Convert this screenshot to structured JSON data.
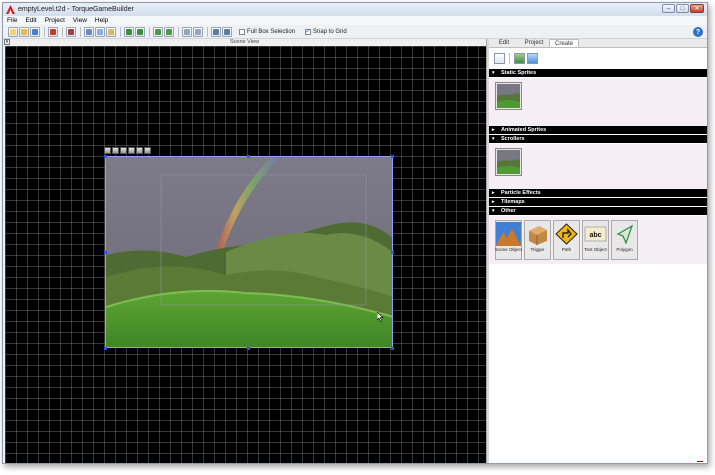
{
  "window": {
    "title": "emptyLevel.t2d - TorqueGameBuilder"
  },
  "menu": [
    "File",
    "Edit",
    "Project",
    "View",
    "Help"
  ],
  "toolbar": {
    "full_box_selection_label": "Full Box Selection",
    "full_box_selection_checked": false,
    "snap_to_grid_label": "Snap to Grid",
    "snap_to_grid_checked": true
  },
  "scene": {
    "title": "Scene View"
  },
  "right_panel": {
    "tabs": [
      "Edit",
      "Project",
      "Create"
    ],
    "active_tab": "Create",
    "categories": [
      {
        "label": "Static Sprites",
        "expanded": true
      },
      {
        "label": "Animated Sprites",
        "expanded": false
      },
      {
        "label": "Scrollers",
        "expanded": true
      },
      {
        "label": "Particle Effects",
        "expanded": false
      },
      {
        "label": "Tilemaps",
        "expanded": false
      },
      {
        "label": "Other",
        "expanded": true
      }
    ],
    "other_items": [
      "Scene Object",
      "Trigger",
      "Path",
      "Text Object",
      "Polygon"
    ],
    "text_object_icon_text": "abc"
  },
  "colors": {
    "scene_background": "#000000",
    "grid": "#787878",
    "category_bar": "#000000",
    "selection_handle": "#3050e0"
  }
}
